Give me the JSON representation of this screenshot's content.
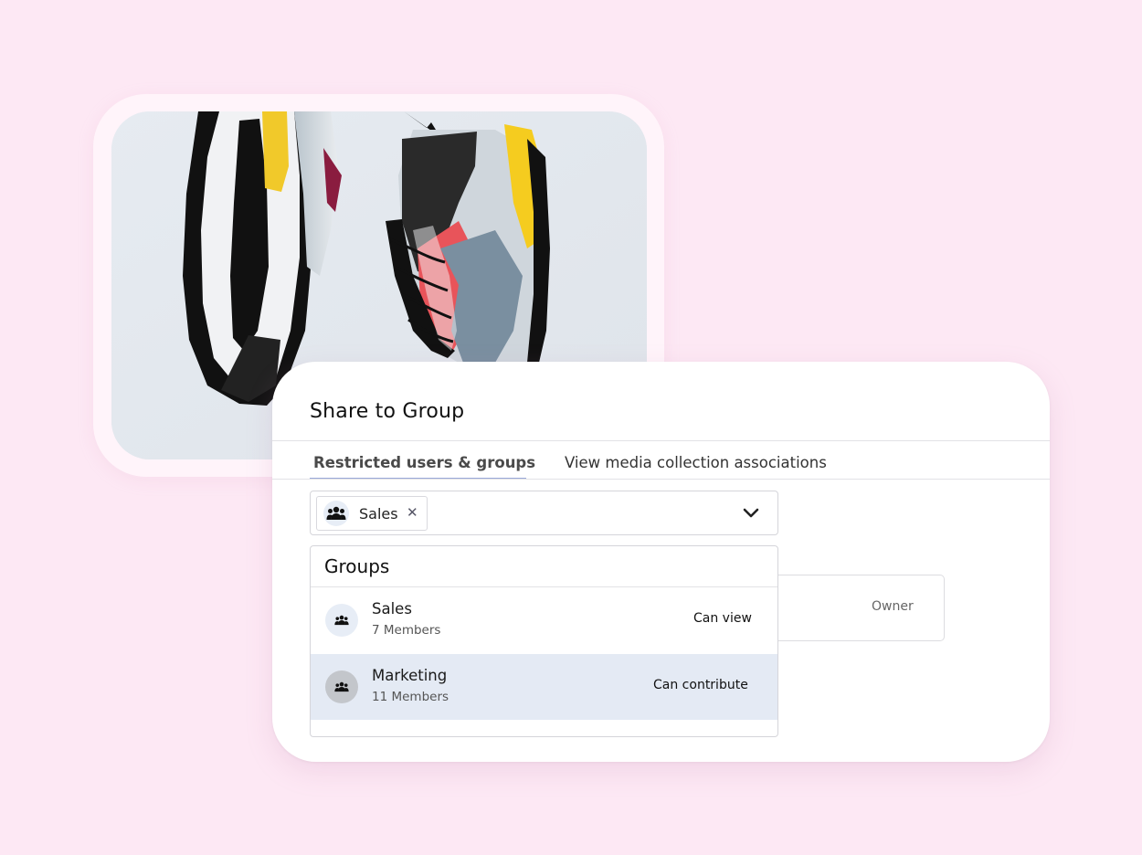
{
  "photo": {
    "subject": "sneakers"
  },
  "dialog": {
    "title": "Share to Group",
    "tabs": [
      {
        "label": "Restricted users & groups",
        "active": true
      },
      {
        "label": "View media collection associations",
        "active": false
      }
    ],
    "selected_chips": [
      {
        "label": "Sales",
        "icon": "group-icon"
      }
    ],
    "owner_label": "Owner"
  },
  "dropdown": {
    "header": "Groups",
    "items": [
      {
        "name": "Sales",
        "members": "7 Members",
        "permission": "Can view",
        "icon": "group-icon",
        "highlighted": false
      },
      {
        "name": "Marketing",
        "members": "11 Members",
        "permission": "Can contribute",
        "icon": "group-icon",
        "highlighted": true
      }
    ]
  },
  "colors": {
    "background": "#fde8f4",
    "tab_underline": "#9aa8d8",
    "highlight_row": "#e4eaf4"
  }
}
